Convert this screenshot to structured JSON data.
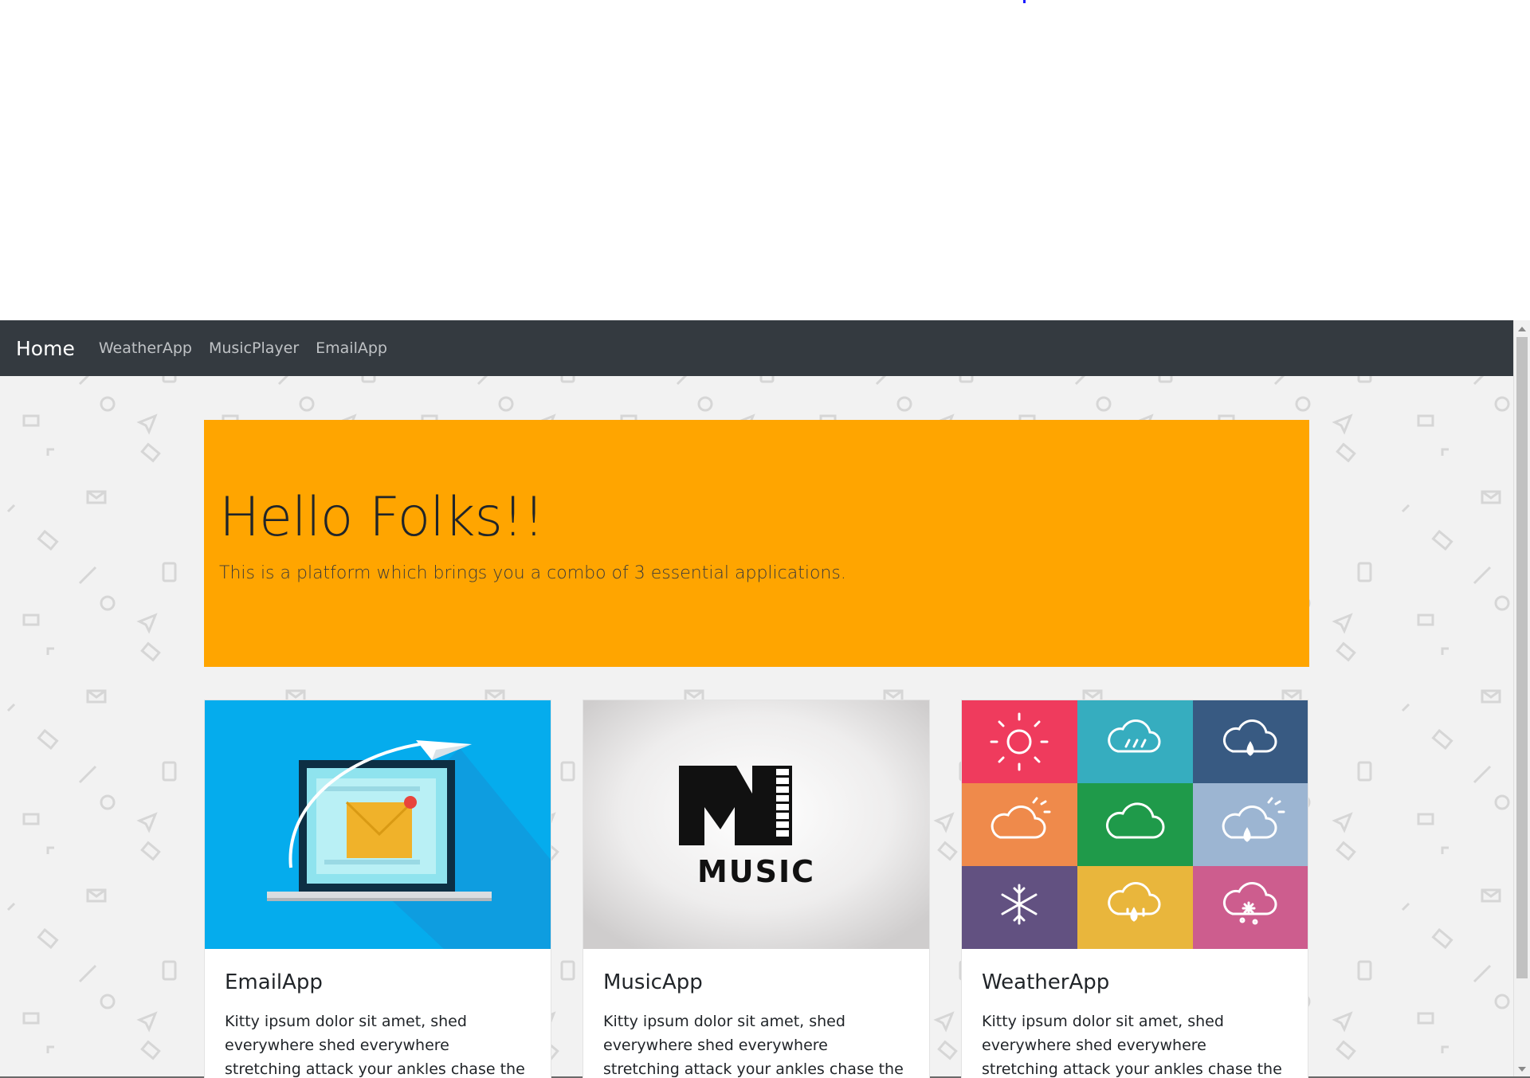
{
  "nav": {
    "brand": "Home",
    "links": [
      "WeatherApp",
      "MusicPlayer",
      "EmailApp"
    ]
  },
  "jumbotron": {
    "title": "Hello Folks!!",
    "subtitle": "This is a platform which brings you a combo of 3 essential applications."
  },
  "cards": [
    {
      "title": "EmailApp",
      "text": "Kitty ipsum dolor sit amet, shed everywhere shed everywhere stretching attack your ankles chase the red dot,"
    },
    {
      "title": "MusicApp",
      "text": "Kitty ipsum dolor sit amet, shed everywhere shed everywhere stretching attack your ankles chase the red dot,",
      "logo_text": "MUSIC"
    },
    {
      "title": "WeatherApp",
      "text": "Kitty ipsum dolor sit amet, shed everywhere shed everywhere stretching attack your ankles chase the red dot,"
    }
  ],
  "colors": {
    "navbar": "#343a40",
    "jumbotron": "#ffa500",
    "email_bg": "#05aced",
    "weather_tiles": [
      "#ef3b5d",
      "#36adbf",
      "#385a82",
      "#ef8a4b",
      "#1f9a4a",
      "#9cb5d2",
      "#625181",
      "#e9b63c",
      "#cd5d8e"
    ]
  },
  "icons": {
    "weather_tiles": [
      "sun-icon",
      "cloud-drizzle-icon",
      "cloud-rain-icon",
      "partly-cloudy-icon",
      "cloud-icon",
      "cloud-sun-rain-icon",
      "snowflake-icon",
      "cloud-hail-icon",
      "cloud-snow-icon"
    ]
  }
}
